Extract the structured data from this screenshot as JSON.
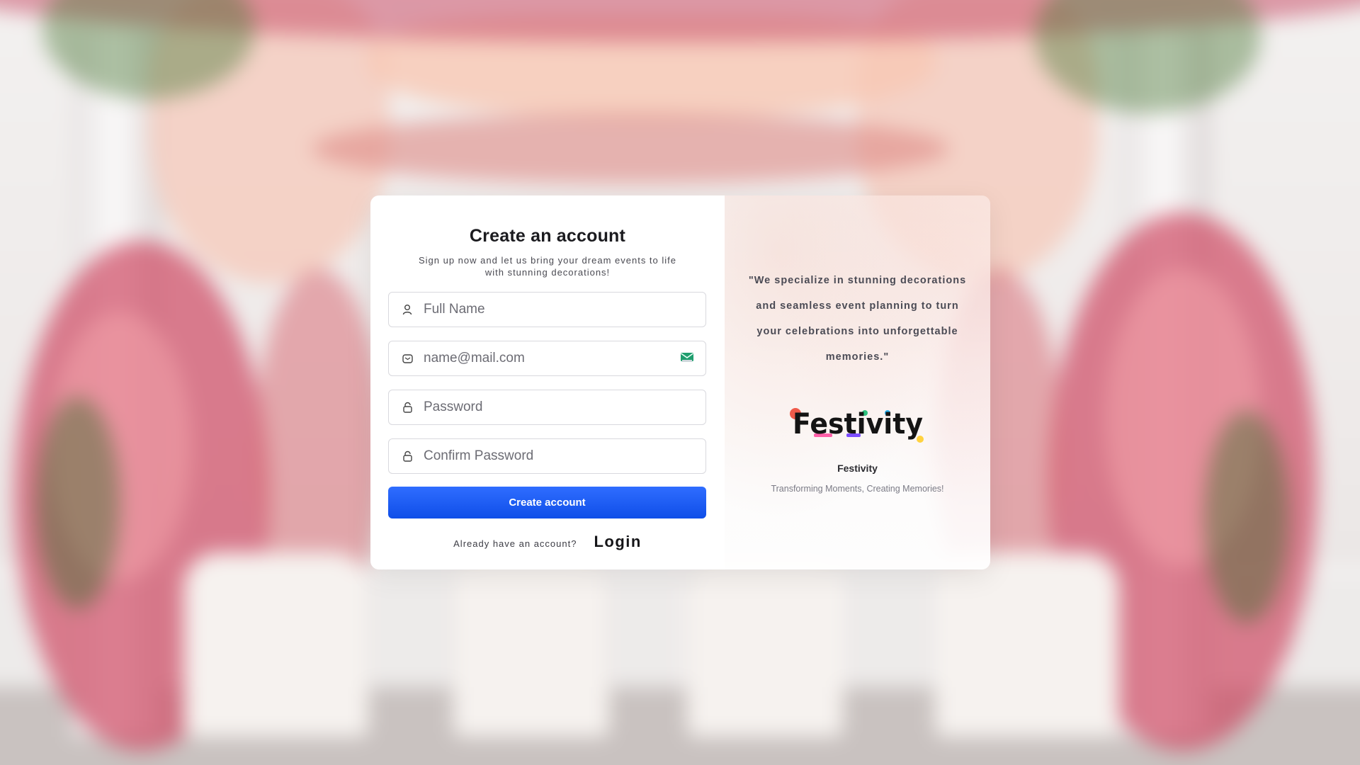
{
  "form": {
    "title": "Create an account",
    "subtitle": "Sign up now and let us bring your dream events to life with stunning decorations!",
    "fields": [
      {
        "icon": "user-icon",
        "placeholder": "Full Name",
        "value": ""
      },
      {
        "icon": "mail-icon",
        "placeholder": "name@mail.com",
        "value": ""
      },
      {
        "icon": "lock-icon",
        "placeholder": "Password",
        "value": ""
      },
      {
        "icon": "lock-icon",
        "placeholder": "Confirm Password",
        "value": ""
      }
    ],
    "submit_label": "Create account",
    "login_prompt": "Already have an account?",
    "login_label": "Login"
  },
  "info": {
    "quote": "\"We specialize in stunning decorations and seamless event planning to turn your celebrations into unforgettable memories.\"",
    "logo_text": "Festivity",
    "brand_name": "Festivity",
    "tagline": "Transforming Moments, Creating Memories!"
  },
  "colors": {
    "accent": "#1a5cf5",
    "card_bg": "#ffffff",
    "border": "#d9d9de"
  }
}
